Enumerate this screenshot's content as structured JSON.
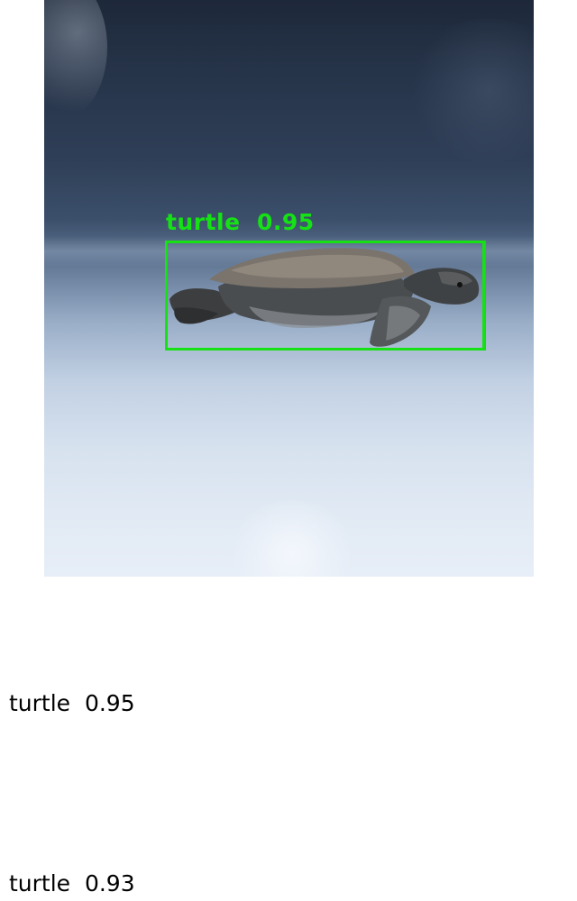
{
  "image": {
    "description_icon": "sea-turtle-photo",
    "box_color": "#15e115",
    "detection": {
      "label": "turtle",
      "score": "0.95",
      "display": "turtle  0.95"
    }
  },
  "results": [
    {
      "text": "turtle  0.95"
    },
    {
      "text": "turtle  0.93"
    }
  ]
}
